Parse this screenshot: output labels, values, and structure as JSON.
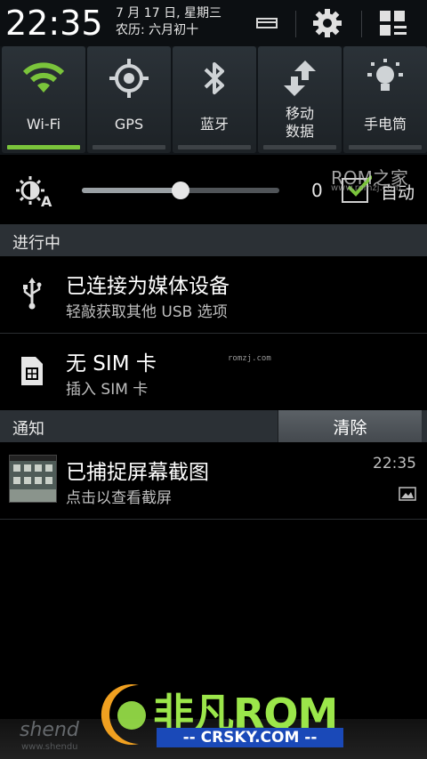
{
  "header": {
    "time": "22:35",
    "date_line1": "7 月 17 日, 星期三",
    "date_line2": "农历: 六月初十"
  },
  "toggles": [
    {
      "label": "Wi-Fi",
      "icon": "wifi-icon",
      "on": true
    },
    {
      "label": "GPS",
      "icon": "gps-icon",
      "on": false
    },
    {
      "label": "蓝牙",
      "icon": "bluetooth-icon",
      "on": false
    },
    {
      "label_line1": "移动",
      "label_line2": "数据",
      "icon": "mobile-data-icon",
      "on": false
    },
    {
      "label": "手电筒",
      "icon": "flashlight-icon",
      "on": false
    }
  ],
  "brightness": {
    "value": "0",
    "level": 0.5,
    "auto_label": "自动",
    "watermark": "ROM之家",
    "watermark_url": "www.romzj.com"
  },
  "ongoing": {
    "title": "进行中",
    "items": [
      {
        "title": "已连接为媒体设备",
        "subtitle": "轻敲获取其他 USB 选项",
        "icon": "usb-icon"
      },
      {
        "title": "无 SIM 卡",
        "subtitle": "插入 SIM 卡",
        "icon": "sim-card-icon"
      }
    ],
    "small_watermark": "romzj.com"
  },
  "notifications": {
    "title": "通知",
    "clear_label": "清除",
    "items": [
      {
        "title": "已捕捉屏幕截图",
        "subtitle": "点击以查看截屏",
        "time": "22:35",
        "icon": "image-icon"
      }
    ]
  },
  "watermark": {
    "brand": "非凡RQM",
    "url": "-- CRSKY.COM --",
    "shen": "shend",
    "shen_url": "www.shendu"
  },
  "colors": {
    "accent_on": "#7ac43b",
    "section_bg": "#2b3035"
  }
}
